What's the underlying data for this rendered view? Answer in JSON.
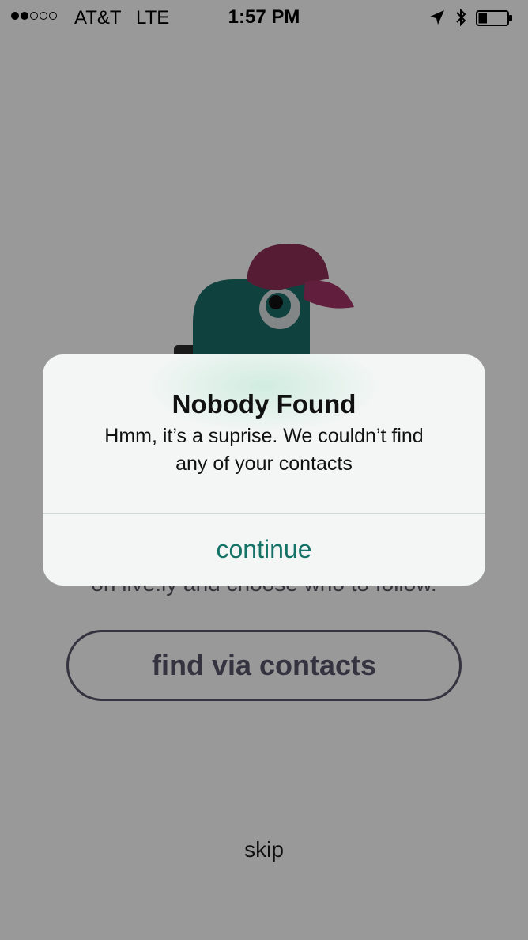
{
  "status_bar": {
    "carrier": "AT&T",
    "network": "LTE",
    "time": "1:57 PM",
    "signal_bars_filled": 2,
    "signal_bars_total": 5,
    "battery_level": 0.3,
    "icons": [
      "location-arrow-icon",
      "bluetooth-icon",
      "battery-icon"
    ]
  },
  "background": {
    "description_visible_line": "on live.ly and choose who to follow.",
    "find_button_label": "find via contacts",
    "skip_label": "skip"
  },
  "alert": {
    "title": "Nobody Found",
    "message_line1": "Hmm, it’s a suprise. We couldn’t find",
    "message_line2": "any of your contacts",
    "action_label": "continue"
  },
  "colors": {
    "mascot_body": "#1a6f6a",
    "mascot_cap": "#8e2f58",
    "alert_action": "#157267",
    "button_outline": "#58556a"
  }
}
